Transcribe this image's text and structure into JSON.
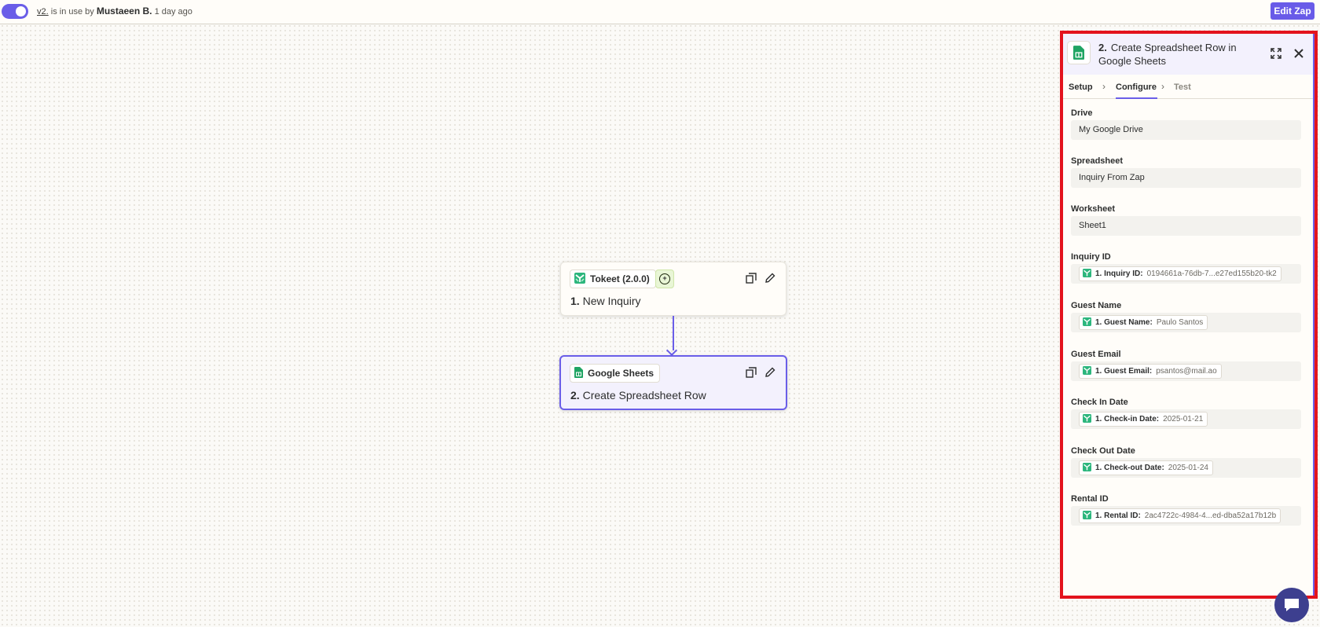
{
  "topbar": {
    "version": "v2.",
    "status_text": " is in use by ",
    "user": "Mustaeen B.",
    "time_ago": " 1 day ago",
    "edit_label": "Edit Zap"
  },
  "steps": [
    {
      "app": "Tokeet (2.0.0)",
      "number": "1.",
      "title": "New Inquiry"
    },
    {
      "app": "Google Sheets",
      "number": "2.",
      "title": "Create Spreadsheet Row"
    }
  ],
  "panel": {
    "number": "2.",
    "title": "Create Spreadsheet Row in Google Sheets",
    "tabs": {
      "setup": "Setup",
      "configure": "Configure",
      "test": "Test"
    },
    "fields": {
      "drive": {
        "label": "Drive",
        "value": "My Google Drive"
      },
      "spreadsheet": {
        "label": "Spreadsheet",
        "value": "Inquiry From Zap"
      },
      "worksheet": {
        "label": "Worksheet",
        "value": "Sheet1"
      },
      "inquiry_id": {
        "label": "Inquiry ID",
        "key": "1. Inquiry ID:",
        "value": "0194661a-76db-7...e27ed155b20-tk2"
      },
      "guest_name": {
        "label": "Guest Name",
        "key": "1. Guest Name:",
        "value": "Paulo Santos"
      },
      "guest_email": {
        "label": "Guest Email",
        "key": "1. Guest Email:",
        "value": "psantos@mail.ao"
      },
      "check_in": {
        "label": "Check In Date",
        "key": "1. Check-in Date:",
        "value": "2025-01-21"
      },
      "check_out": {
        "label": "Check Out Date",
        "key": "1. Check-out Date:",
        "value": "2025-01-24"
      },
      "rental_id": {
        "label": "Rental ID",
        "key": "1. Rental ID:",
        "value": "2ac4722c-4984-4...ed-dba52a17b12b"
      }
    }
  },
  "colors": {
    "accent": "#6a5ee8",
    "highlight_border": "#e3131d",
    "sheets_green": "#1fa463",
    "tokeet_green": "#2cb67d"
  },
  "icons": [
    "toggle",
    "tokeet-icon",
    "trigger-icon",
    "copy-icon",
    "pencil-icon",
    "google-sheets-icon",
    "expand-icon",
    "close-icon",
    "chevron-right-icon",
    "chat-icon"
  ]
}
